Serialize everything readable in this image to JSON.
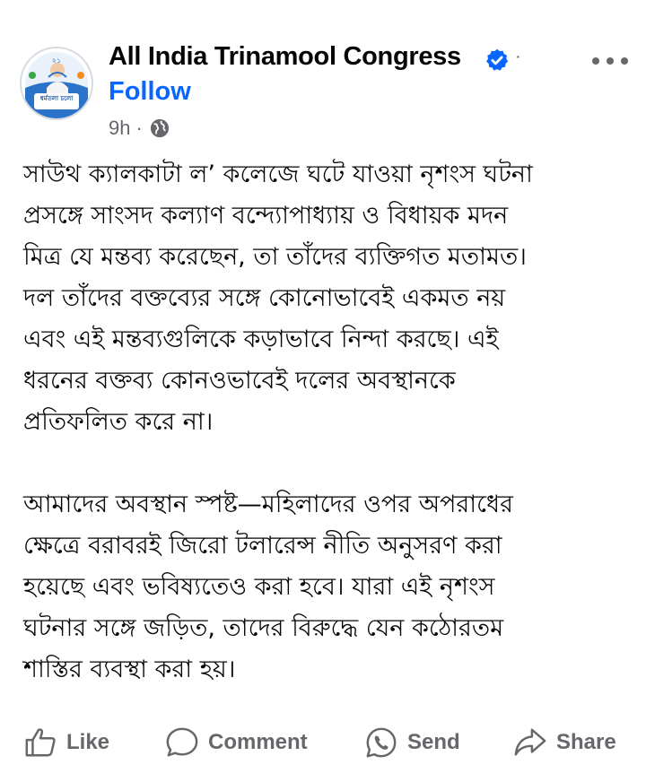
{
  "post": {
    "page_name": "All India Trinamool Congress",
    "follow_label": "Follow",
    "time": "9h",
    "time_separator": "·",
    "name_separator": "·",
    "verified_color": "#0866ff",
    "paragraphs": [
      "সাউথ ক্যালকাটা ল’ কলেজে ঘটে যাওয়া নৃশংস ঘটনা\nপ্রসঙ্গে সাংসদ কল্যাণ বন্দ্যোপাধ্যায় ও বিধায়ক মদন\nমিত্র যে মন্তব্য করেছেন, তা তাঁদের ব্যক্তিগত মতামত।\nদল তাঁদের বক্তব্যের সঙ্গে কোনোভাবেই একমত নয়\nএবং এই মন্তব্যগুলিকে কড়াভাবে নিন্দা করছে। এই\nধরনের বক্তব্য কোনওভাবেই দলের অবস্থানকে\nপ্রতিফলিত করে না।",
      "আমাদের অবস্থান স্পষ্ট—মহিলাদের ওপর অপরাধের\nক্ষেত্রে বরাবরই জিরো টলারেন্স নীতি অনুসরণ করা\nহয়েছে এবং ভবিষ্যতেও করা হবে। যারা এই নৃশংস\nঘটনার সঙ্গে জড়িত, তাদের বিরুদ্ধে যেন কঠোরতম\nশাস্তির ব্যবস্থা করা হয়।"
    ],
    "avatar_logo_text": "২১",
    "avatar_banner_text": "ধর্মতলা চলো"
  },
  "actions": {
    "like": "Like",
    "comment": "Comment",
    "send": "Send",
    "share": "Share"
  }
}
